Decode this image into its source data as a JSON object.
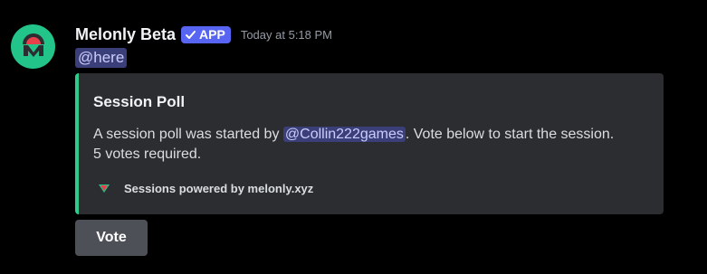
{
  "message": {
    "author": "Melonly Beta",
    "badge": {
      "icon": "check-icon",
      "label": "APP",
      "color": "#5865f2"
    },
    "timestamp": "Today at 5:18 PM",
    "avatar": {
      "icon": "melonly-logo-icon",
      "color": "#23c48a"
    },
    "content_mention": "@here"
  },
  "embed": {
    "accent_color": "#2ecc8a",
    "title": "Session Poll",
    "description_prefix": "A session poll was started by ",
    "description_mention": "@Collin222games",
    "description_suffix": ". Vote below to start the session.",
    "description_line2": "5 votes required.",
    "footer": {
      "icon": "melonly-logo-icon",
      "text": "Sessions powered by melonly.xyz"
    }
  },
  "buttons": {
    "vote_label": "Vote"
  }
}
